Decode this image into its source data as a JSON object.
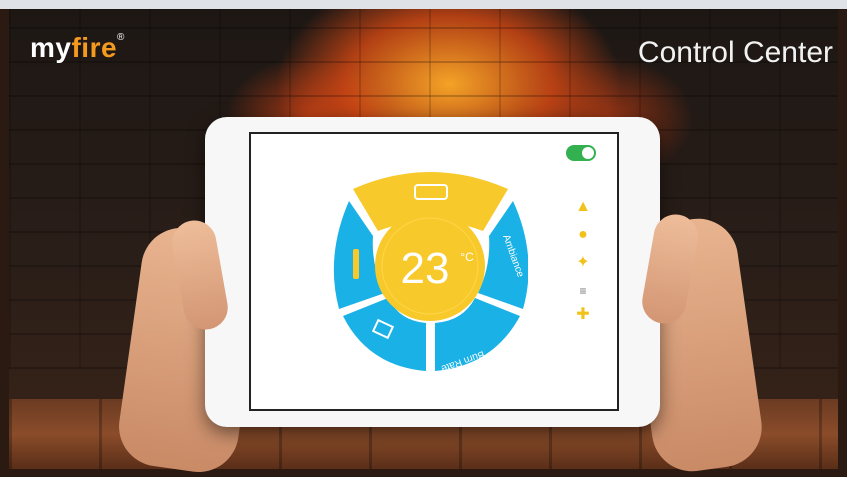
{
  "brand": {
    "logo_prefix": "my",
    "logo_fire": "fire",
    "logo_mark": "®"
  },
  "header": {
    "title": "Control Center"
  },
  "tablet": {
    "toggle_on": true,
    "dial": {
      "temperature": "23",
      "unit": "°C",
      "segments": [
        {
          "id": "top",
          "icon": "sofa-icon"
        },
        {
          "id": "right",
          "label": "Ambiance"
        },
        {
          "id": "bottom-right",
          "label": "Burn Rate"
        },
        {
          "id": "bottom-left",
          "icon": "book-icon"
        },
        {
          "id": "left",
          "icon": "candle-icon"
        }
      ],
      "colors": {
        "blue": "#1ab1e6",
        "yellow": "#f7c92a"
      }
    },
    "side_icons": [
      "flame-icon",
      "bulb-icon",
      "sparkle-icon",
      "separator-icon",
      "settings-icon"
    ]
  }
}
